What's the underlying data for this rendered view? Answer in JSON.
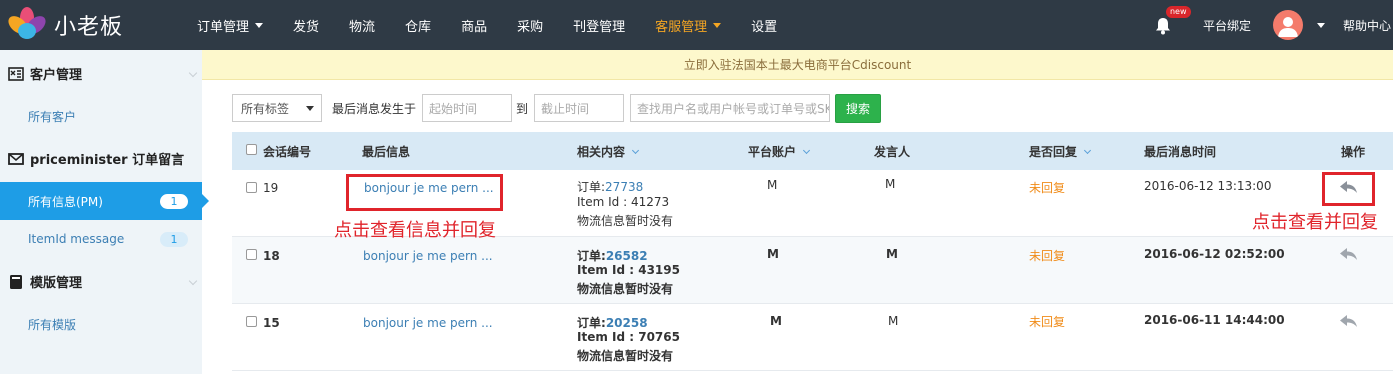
{
  "app": {
    "name": "小老板"
  },
  "nav": {
    "items": [
      {
        "label": "订单管理",
        "dropdown": true,
        "active": false
      },
      {
        "label": "发货",
        "dropdown": false,
        "active": false
      },
      {
        "label": "物流",
        "dropdown": false,
        "active": false
      },
      {
        "label": "仓库",
        "dropdown": false,
        "active": false
      },
      {
        "label": "商品",
        "dropdown": false,
        "active": false
      },
      {
        "label": "采购",
        "dropdown": false,
        "active": false
      },
      {
        "label": "刊登管理",
        "dropdown": false,
        "active": false
      },
      {
        "label": "客服管理",
        "dropdown": true,
        "active": true
      },
      {
        "label": "设置",
        "dropdown": false,
        "active": false
      }
    ],
    "new_badge": "new",
    "platform_bind": "平台绑定",
    "help_center": "帮助中心"
  },
  "sidebar": {
    "groups": [
      {
        "label": "客户管理",
        "icon": "customer-icon",
        "items": [
          {
            "label": "所有客户",
            "count": ""
          }
        ]
      },
      {
        "label": "priceminister 订单留言",
        "icon": "mail-icon",
        "items": [
          {
            "label": "所有信息(PM)",
            "count": "1",
            "active": true
          },
          {
            "label": "ItemId message",
            "count": "1",
            "active": false
          }
        ]
      },
      {
        "label": "模版管理",
        "icon": "template-icon",
        "items": [
          {
            "label": "所有模版",
            "count": ""
          }
        ]
      }
    ]
  },
  "notice": "立即入驻法国本土最大电商平台Cdiscount",
  "filters": {
    "tag_select": "所有标签",
    "last_msg_label": "最后消息发生于",
    "start_placeholder": "起始时间",
    "to_label": "到",
    "end_placeholder": "截止时间",
    "search_placeholder": "查找用户名或用户帐号或订单号或SKU",
    "search_button": "搜索"
  },
  "table": {
    "headers": {
      "id": "会话编号",
      "last_msg": "最后信息",
      "related": "相关内容",
      "platform_account": "平台账户",
      "speaker": "发言人",
      "replied": "是否回复",
      "last_time": "最后消息时间",
      "action": "操作"
    },
    "rows": [
      {
        "id": "19",
        "message": "bonjour je me pern ...",
        "order_label": "订单:",
        "order_no": "27738",
        "item_id": "Item Id : 41273",
        "logistics": "物流信息暂时没有",
        "account": "M",
        "speaker": "M",
        "replied": "未回复",
        "time": "2016-06-12 13:13:00",
        "bold": false
      },
      {
        "id": "18",
        "message": "bonjour je me pern ...",
        "order_label": "订单:",
        "order_no": "26582",
        "item_id": "Item Id : 43195",
        "logistics": "物流信息暂时没有",
        "account": "M",
        "speaker": "M",
        "replied": "未回复",
        "time": "2016-06-12 02:52:00",
        "bold": true
      },
      {
        "id": "15",
        "message": "bonjour je me pern ...",
        "order_label": "订单:",
        "order_no": "20258",
        "item_id": "Item Id : 70765",
        "logistics": "物流信息暂时没有",
        "account": "M",
        "speaker": "M",
        "replied": "未回复",
        "time": "2016-06-11 14:44:00",
        "bold": true
      }
    ]
  },
  "annotations": {
    "view_reply": "点击查看信息并回复",
    "click_reply": "点击查看并回复"
  },
  "colors": {
    "topbar": "#2f3a45",
    "active_nav": "#f5a623",
    "sidebar_active": "#1e9de6",
    "search_button": "#2db24c",
    "annotation": "#e0242b"
  }
}
